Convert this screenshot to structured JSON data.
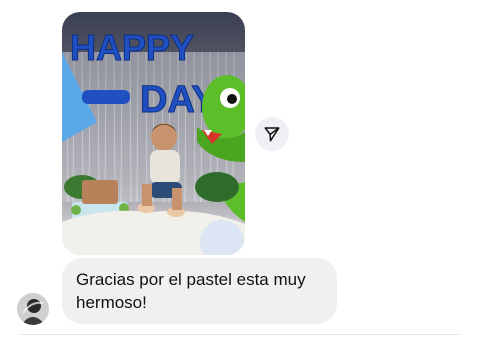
{
  "message": {
    "image_alt": "Birthday photo of a baby sitting on a blanket with blue HAPPY BIRTHDAY balloons and a green dinosaur balloon",
    "balloon_text_top": "HAPPY",
    "balloon_text_bottom": "DAY",
    "text": "Gracias por el pastel esta muy hermoso!"
  },
  "actions": {
    "share_icon": "paper-plane-icon"
  },
  "colors": {
    "bubble_bg": "#eff0f2",
    "balloon_blue": "#1f4fc1",
    "dino_green": "#5cbf2a"
  }
}
